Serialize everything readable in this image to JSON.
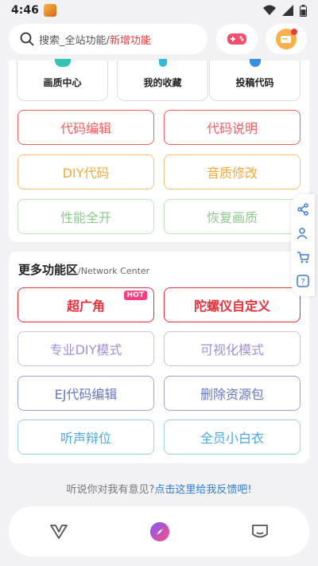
{
  "status_bar": {
    "time": "4:46",
    "icons": [
      "app-badge-icon",
      "wifi-icon",
      "signal-icon",
      "battery-icon"
    ]
  },
  "search": {
    "placeholder": "搜索_全站功能/",
    "highlight": "新增功能"
  },
  "top_icons": [
    "gamepad-icon",
    "message-icon"
  ],
  "top_cards": [
    {
      "label": "画质中心",
      "icon": "quality-center-icon"
    },
    {
      "label": "我的收藏",
      "icon": "favorites-icon"
    },
    {
      "label": "投稿代码",
      "icon": "submit-code-icon"
    }
  ],
  "panel1_buttons": [
    {
      "label": "代码编辑",
      "color": "#f1605f"
    },
    {
      "label": "代码说明",
      "color": "#f1605f"
    },
    {
      "label": "DIY代码",
      "color": "#f5a93a"
    },
    {
      "label": "音质修改",
      "color": "#f5a93a"
    },
    {
      "label": "性能全开",
      "color": "#8cca8a"
    },
    {
      "label": "恢复画质",
      "color": "#8cca8a"
    }
  ],
  "section": {
    "title": "更多功能区",
    "subtitle": "/Network Center"
  },
  "panel2_buttons": [
    {
      "label": "超广角",
      "color": "#e8303a",
      "badge": "HOT"
    },
    {
      "label": "陀螺仪自定义",
      "color": "#e8303a"
    },
    {
      "label": "专业DIY模式",
      "color": "#a48fd6"
    },
    {
      "label": "可视化模式",
      "color": "#a48fd6"
    },
    {
      "label": "EJ代码编辑",
      "color": "#6577c4"
    },
    {
      "label": "删除资源包",
      "color": "#6577c4"
    },
    {
      "label": "听声辩位",
      "color": "#49a7e4"
    },
    {
      "label": "全员小白衣",
      "color": "#49a7e4"
    }
  ],
  "side_toolbar": [
    "share-icon",
    "users-icon",
    "cart-icon",
    "help-icon"
  ],
  "feedback": {
    "text": "听说你对我有意见?",
    "link": "点击这里给我反馈吧!"
  },
  "bottom_nav": [
    "home-v-icon",
    "center-compass-icon",
    "profile-icon"
  ]
}
